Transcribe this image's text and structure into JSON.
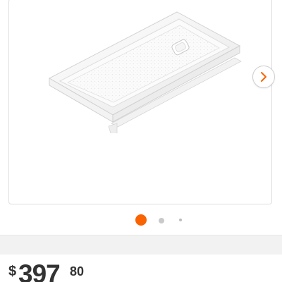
{
  "product": {
    "image_name": "shower-base-product-image",
    "carousel": {
      "next_icon": "chevron-right-icon",
      "active_color": "#f96302",
      "dots": 3,
      "active_index": 0
    }
  },
  "price": {
    "currency_symbol": "$",
    "dollars": "397",
    "cents": "80",
    "text_color": "#333333"
  },
  "colors": {
    "brand_orange": "#f96302",
    "border": "#dedede",
    "section_background": "#f2f2f2"
  }
}
